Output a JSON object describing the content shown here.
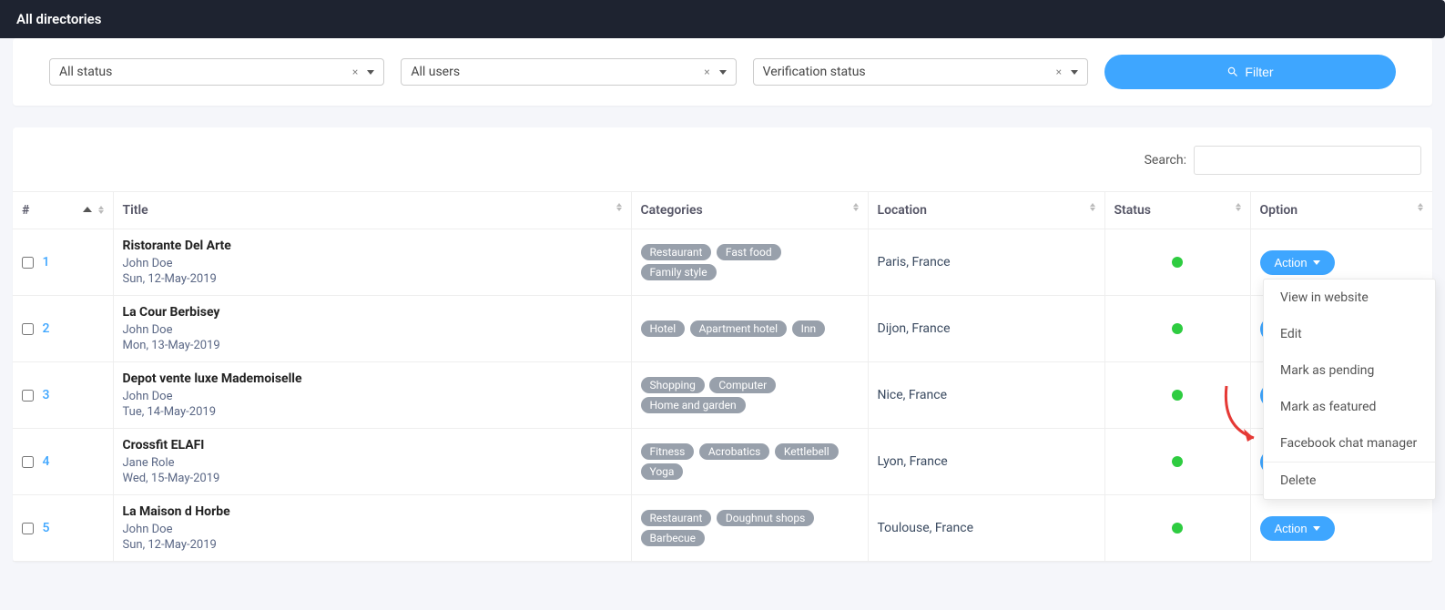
{
  "header": {
    "title": "All directories"
  },
  "filters": {
    "status": "All status",
    "users": "All users",
    "verification": "Verification status",
    "button": "Filter"
  },
  "search": {
    "label": "Search:"
  },
  "columns": {
    "num": "#",
    "title": "Title",
    "categories": "Categories",
    "location": "Location",
    "status": "Status",
    "option": "Option"
  },
  "action_label": "Action",
  "rows": [
    {
      "num": "1",
      "title": "Ristorante Del Arte",
      "user": "John Doe",
      "date": "Sun, 12-May-2019",
      "cats": [
        "Restaurant",
        "Fast food",
        "Family style"
      ],
      "location": "Paris, France"
    },
    {
      "num": "2",
      "title": "La Cour Berbisey",
      "user": "John Doe",
      "date": "Mon, 13-May-2019",
      "cats": [
        "Hotel",
        "Apartment hotel",
        "Inn"
      ],
      "location": "Dijon, France"
    },
    {
      "num": "3",
      "title": "Depot vente luxe Mademoiselle",
      "user": "John Doe",
      "date": "Tue, 14-May-2019",
      "cats": [
        "Shopping",
        "Computer",
        "Home and garden"
      ],
      "location": "Nice, France"
    },
    {
      "num": "4",
      "title": "Crossfit ELAFI",
      "user": "Jane Role",
      "date": "Wed, 15-May-2019",
      "cats": [
        "Fitness",
        "Acrobatics",
        "Kettlebell",
        "Yoga"
      ],
      "location": "Lyon, France"
    },
    {
      "num": "5",
      "title": "La Maison d Horbe",
      "user": "John Doe",
      "date": "Sun, 12-May-2019",
      "cats": [
        "Restaurant",
        "Doughnut shops",
        "Barbecue"
      ],
      "location": "Toulouse, France"
    }
  ],
  "dropdown": {
    "view": "View in website",
    "edit": "Edit",
    "pending": "Mark as pending",
    "featured": "Mark as featured",
    "fb": "Facebook chat manager",
    "delete": "Delete"
  }
}
